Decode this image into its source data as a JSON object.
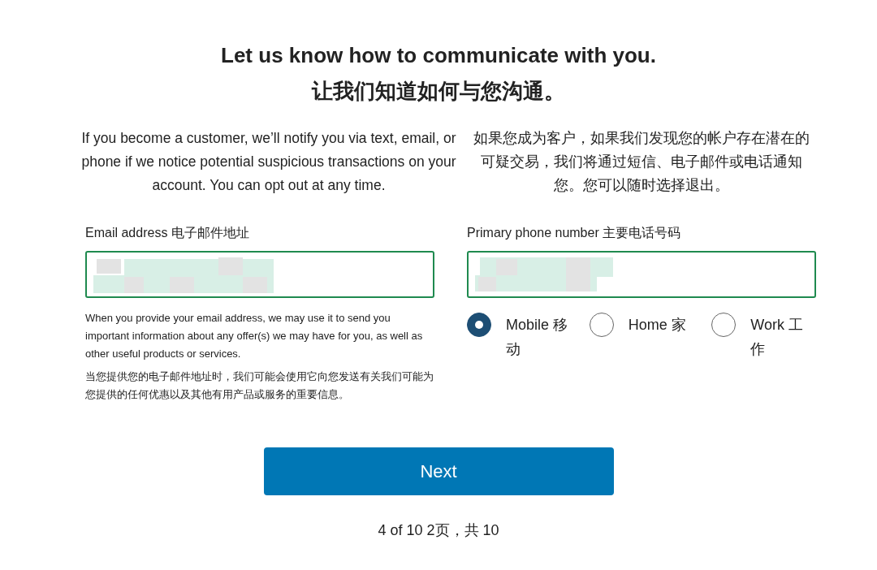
{
  "heading": "Let us know how to communicate with you.",
  "heading_zh": "让我们知道如何与您沟通。",
  "intro": "If you become a customer, we’ll notify you via text, email, or phone if we notice potential suspicious transactions on your account. You can opt out at any time.",
  "intro_zh": "如果您成为客户，如果我们发现您的帐户存在潜在的可疑交易，我们将通过短信、电子邮件或电话通知您。您可以随时选择退出。",
  "email": {
    "label": "Email address 电子邮件地址",
    "note": "When you provide your email address, we may use it to send you important information about any offer(s) we may have for you, as well as other useful products or services.",
    "note_zh": "当您提供您的电子邮件地址时，我们可能会使用它向您发送有关我们可能为您提供的任何优惠以及其他有用产品或服务的重要信息。"
  },
  "phone": {
    "label": "Primary phone number 主要电话号码",
    "types": [
      {
        "label": "Mobile 移动",
        "selected": true
      },
      {
        "label": "Home 家",
        "selected": false
      },
      {
        "label": "Work 工作",
        "selected": false
      }
    ]
  },
  "next_button": "Next",
  "progress": "4 of 10  2页，共 10"
}
